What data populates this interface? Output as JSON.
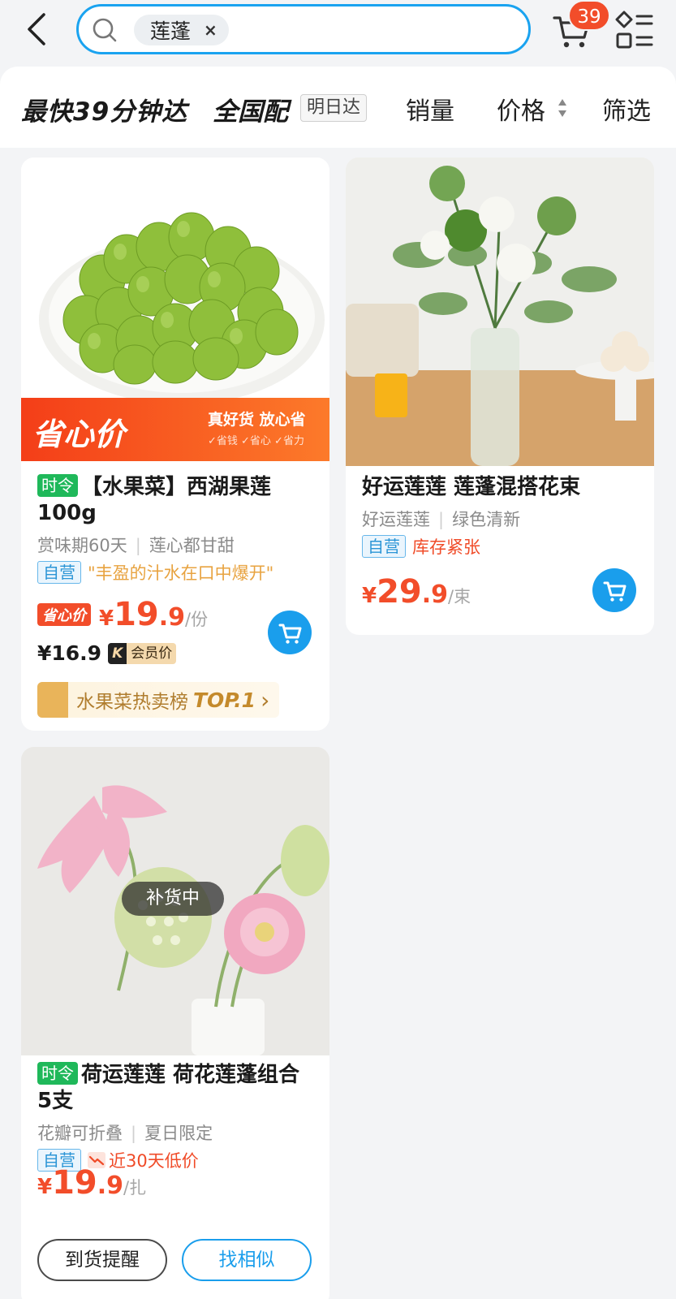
{
  "header": {
    "search_keyword": "莲蓬",
    "clear_symbol": "×",
    "cart_badge": "39"
  },
  "filters": {
    "fastest": "最快39分钟达",
    "nationwide": "全国配",
    "tomorrow": "明日达",
    "sales": "销量",
    "price": "价格",
    "filter": "筛选"
  },
  "products": [
    {
      "tag": "时令",
      "title": "【水果菜】西湖果莲100g",
      "subtitle_a": "赏味期60天",
      "subtitle_b": "莲心都甘甜",
      "self_tag": "自营",
      "quote": "\"丰盈的汁水在口中爆开\"",
      "promo_banner": "省心价",
      "promo_slogan": "真好货 放心省",
      "promo_minis": "✓省钱  ✓省心  ✓省力",
      "price_tag": "省心价",
      "price_yen": "¥",
      "price_int": "19",
      "price_dec": ".9",
      "price_unit": "/份",
      "member_price": "¥16.9",
      "member_k": "K",
      "member_label": "会员价",
      "rank_label": "水果菜热卖榜",
      "rank_top": "TOP.1",
      "rank_arrow": "›"
    },
    {
      "title": "好运莲莲 莲蓬混搭花束",
      "subtitle_a": "好运莲莲",
      "subtitle_b": "绿色清新",
      "self_tag": "自营",
      "stock": "库存紧张",
      "price_yen": "¥",
      "price_int": "29",
      "price_dec": ".9",
      "price_unit": "/束"
    },
    {
      "tag": "时令",
      "title": "荷运莲莲 荷花莲蓬组合 5支",
      "subtitle_a": "花瓣可折叠",
      "subtitle_b": "夏日限定",
      "self_tag": "自营",
      "low_price": "近30天低价",
      "overlay": "补货中",
      "price_yen": "¥",
      "price_int": "19",
      "price_dec": ".9",
      "price_unit": "/扎",
      "remind_button": "到货提醒",
      "similar_button": "找相似"
    }
  ],
  "colors": {
    "accent_blue": "#1a9eec",
    "price_red": "#f24d2a",
    "season_green": "#1fb85a"
  }
}
